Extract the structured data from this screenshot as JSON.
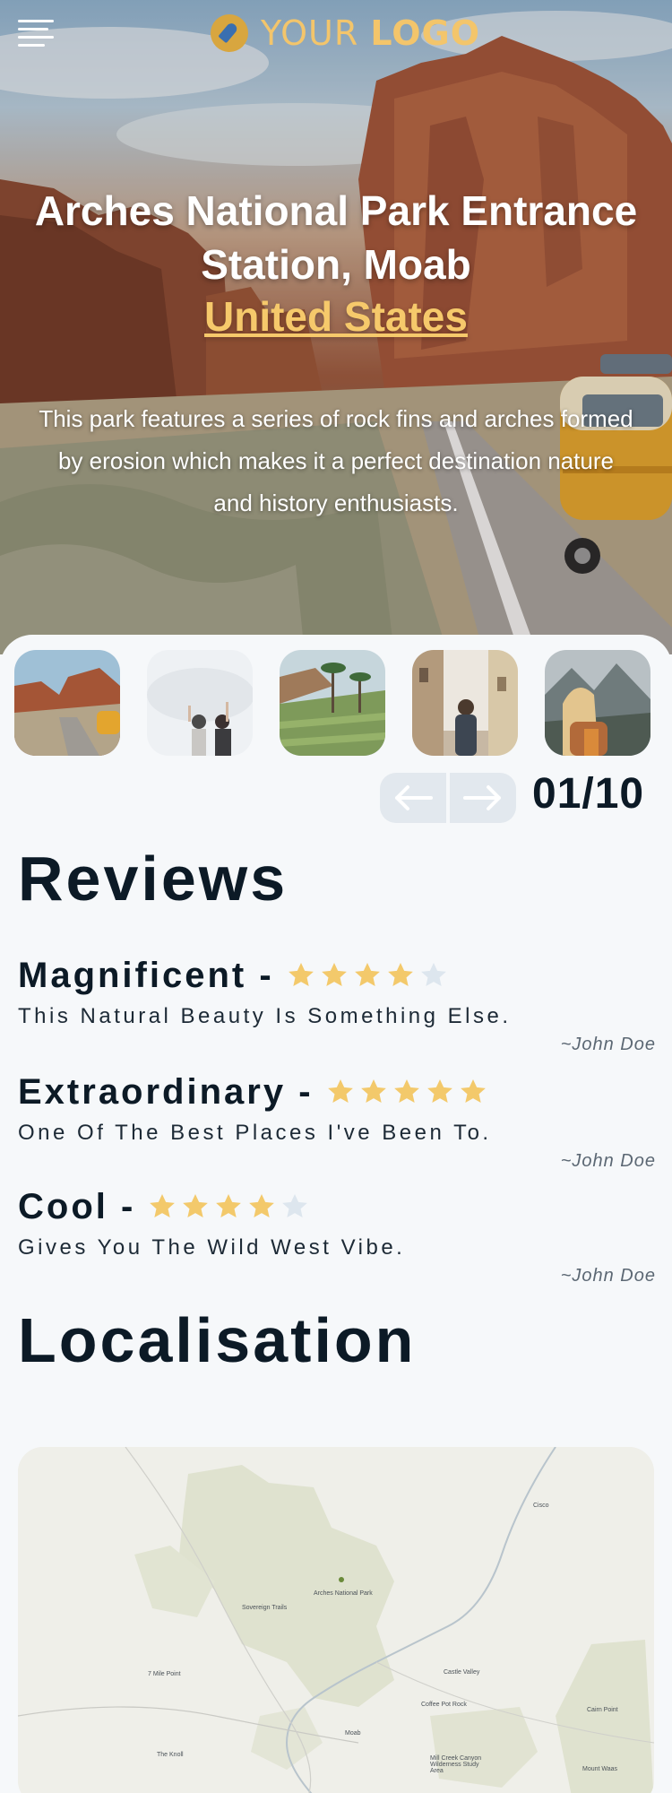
{
  "header": {
    "logo_text_light": "YOUR",
    "logo_text_bold": "LOGO",
    "menu_icon": "hamburger-menu-icon"
  },
  "hero": {
    "title": "Arches National Park Entrance Station, Moab",
    "country": "United States",
    "description": "This park features a series of rock fins and arches formed by erosion which makes it a perfect destination nature and history enthusiasts."
  },
  "gallery": {
    "counter": "01/10",
    "prev_icon": "arrow-left-icon",
    "next_icon": "arrow-right-icon",
    "thumbnails": [
      {
        "subject": "red rock canyon road with van"
      },
      {
        "subject": "two people raising hands in fog"
      },
      {
        "subject": "palm trees over rice terraces"
      },
      {
        "subject": "man in old town street"
      },
      {
        "subject": "blonde woman facing mountains"
      }
    ]
  },
  "reviews": {
    "heading": "Reviews",
    "items": [
      {
        "title": "Magnificent -",
        "rating": 4,
        "text": "This Natural Beauty Is Something Else.",
        "author": "~John Doe"
      },
      {
        "title": "Extraordinary -",
        "rating": 5,
        "text": "One Of The Best Places I've Been To.",
        "author": "~John Doe"
      },
      {
        "title": "Cool -",
        "rating": 4,
        "text": "Gives You The Wild West Vibe.",
        "author": "~John Doe"
      }
    ]
  },
  "localisation": {
    "heading": "Localisation",
    "map_labels": [
      "Arches National Park",
      "Sovereign Trails",
      "7 Mile Point",
      "Castle Valley",
      "Coffee Pot Rock",
      "Cairn Point",
      "Moab",
      "The Knoll",
      "Mill Creek Canyon Wilderness Study Area",
      "Mount Waas",
      "Cisco"
    ]
  },
  "colors": {
    "accent": "#f6c96b",
    "star_filled": "#f3c96b",
    "star_empty": "#dde6ee",
    "text_dark": "#0c1a26",
    "arrow_bg": "#e2e8ee"
  }
}
